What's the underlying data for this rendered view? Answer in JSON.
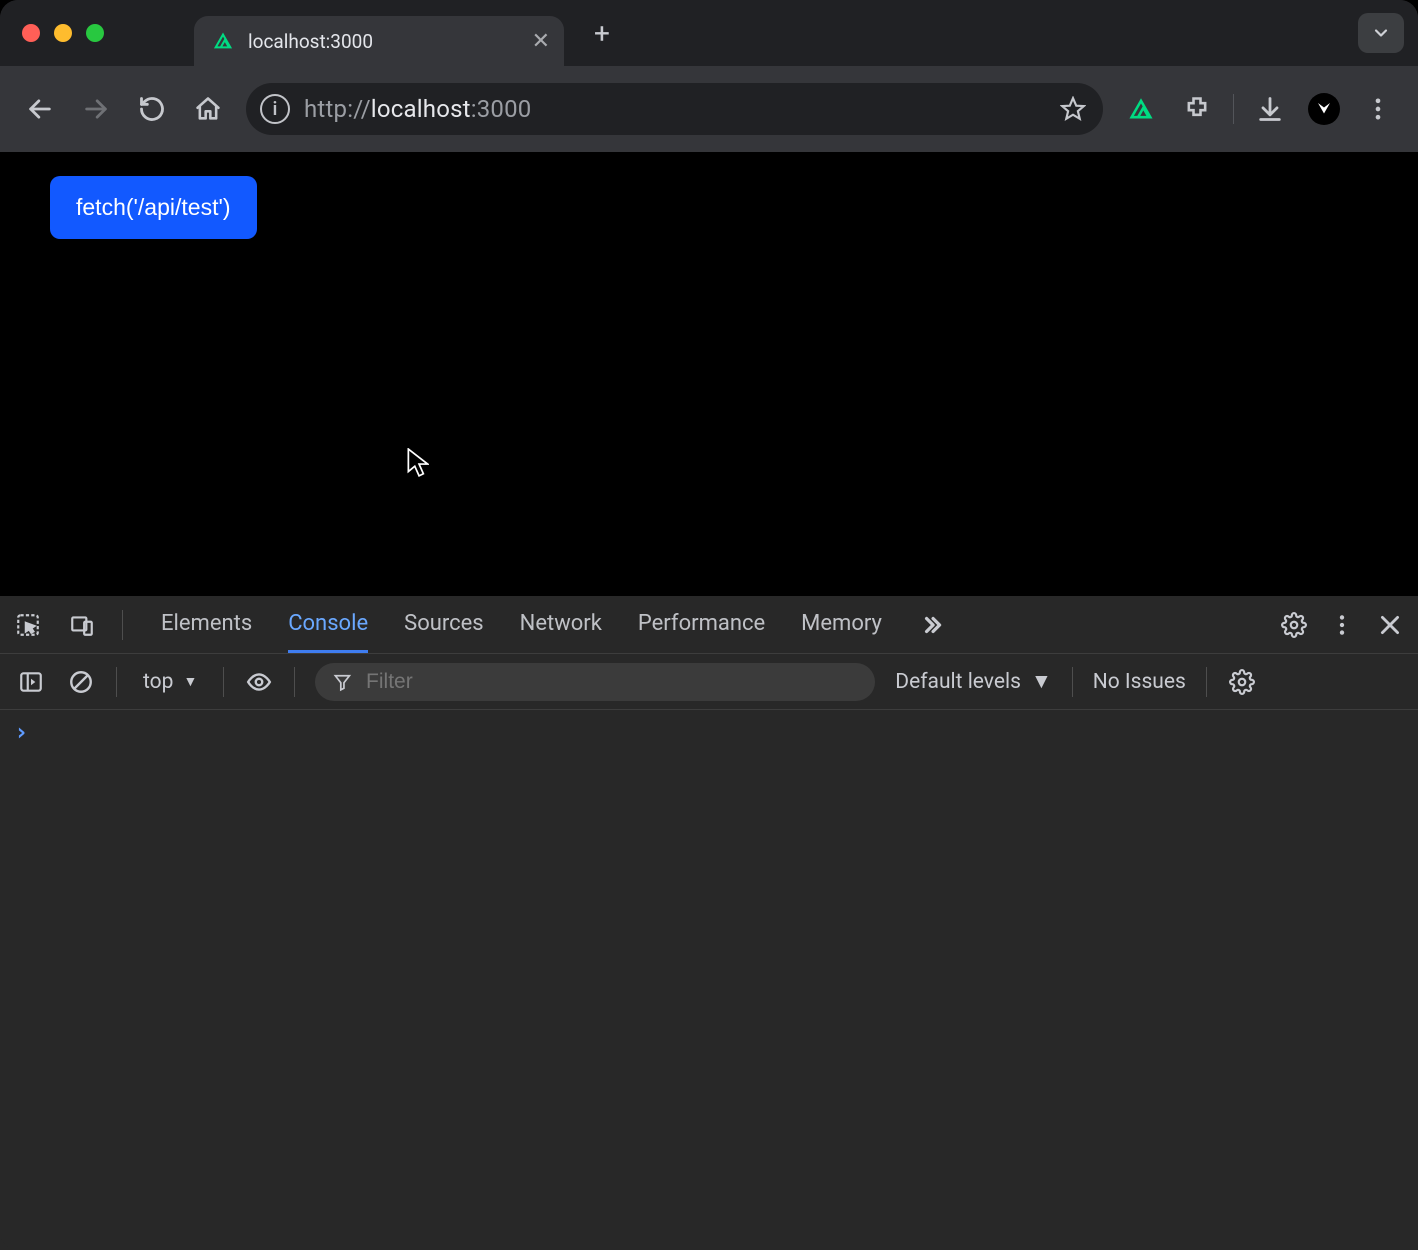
{
  "browser": {
    "tab_title": "localhost:3000",
    "address_bar_scheme": "http://",
    "address_bar_host": "localhost",
    "address_bar_port": ":3000"
  },
  "page": {
    "fetch_button_label": "fetch('/api/test')"
  },
  "devtools": {
    "tabs": [
      "Elements",
      "Console",
      "Sources",
      "Network",
      "Performance",
      "Memory"
    ],
    "active_tab": "Console",
    "console": {
      "context": "top",
      "filter_placeholder": "Filter",
      "levels_label": "Default levels",
      "issues_label": "No Issues",
      "prompt": "›"
    }
  }
}
